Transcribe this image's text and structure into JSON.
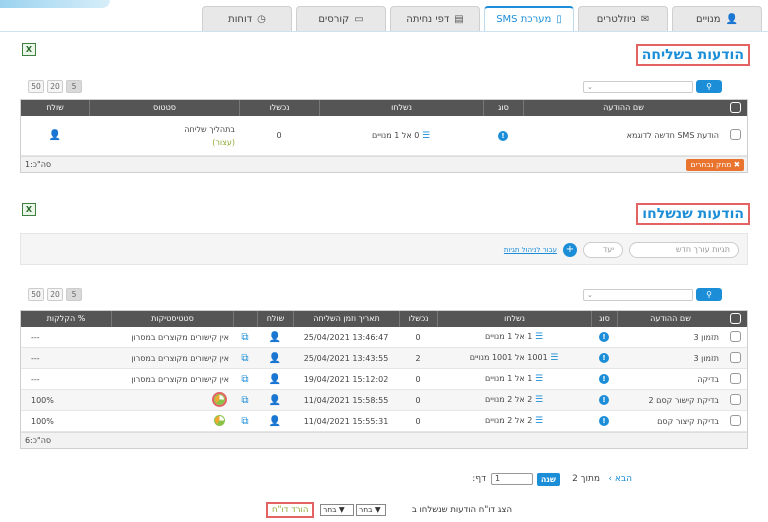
{
  "tabs": [
    {
      "label": "מנויים",
      "icon": "user-icon"
    },
    {
      "label": "ניוזלטרים",
      "icon": "envelope-icon"
    },
    {
      "label": "מערכת SMS",
      "icon": "mobile-icon",
      "active": true
    },
    {
      "label": "דפי נחיתה",
      "icon": "landing-page-icon"
    },
    {
      "label": "קורסים",
      "icon": "monitor-icon"
    },
    {
      "label": "דוחות",
      "icon": "clock-icon"
    }
  ],
  "sending": {
    "title": "הודעות בשליחה",
    "page_sizes": [
      "5",
      "20",
      "50"
    ],
    "columns": [
      "שם ההודעה",
      "סוג",
      "נשלחו",
      "נכשלו",
      "סטטוס",
      "שולח"
    ],
    "rows": [
      {
        "name": "הודעת SMS חדשה לדוגמא",
        "sent": "0 אל 1 מנויים",
        "failed": "0",
        "status": "בתהליך שליחה",
        "status_sub": "(עצור)"
      }
    ],
    "delete_label": "מחק נבחרים",
    "total": "סה\"כ:1"
  },
  "sent": {
    "title": "הודעות שנשלחו",
    "filter": {
      "tags_placeholder": "תגיות עורך חדש",
      "target_placeholder": "יעד",
      "manage_tags_link": "עבור לניהול תגיות"
    },
    "page_sizes": [
      "5",
      "20",
      "50"
    ],
    "columns": [
      "שם ההודעה",
      "סוג",
      "נשלחו",
      "נכשלו",
      "תאריך וזמן השליחה",
      "שולח",
      "",
      "סטטיסטיקות",
      "% הקלקות"
    ],
    "rows": [
      {
        "name": "תזמון 3",
        "sent": "1 אל 1 מנויים",
        "failed": "0",
        "date": "13:46:47 25/04/2021",
        "stats": "אין קישורים מקוצרים במסרון",
        "clicks": "---"
      },
      {
        "name": "תזמון 3",
        "sent": "1001 אל 1001 מנויים",
        "failed": "2",
        "date": "13:43:55 25/04/2021",
        "stats": "אין קישורים מקוצרים במסרון",
        "clicks": "---"
      },
      {
        "name": "בדיקה",
        "sent": "1 אל 1 מנויים",
        "failed": "0",
        "date": "15:12:02 19/04/2021",
        "stats": "אין קישורים מקוצרים במסרון",
        "clicks": "---"
      },
      {
        "name": "בדיקת קישור קסם 2",
        "sent": "2 אל 2 מנויים",
        "failed": "0",
        "date": "15:58:55 11/04/2021",
        "stats": "",
        "clicks": "100%"
      },
      {
        "name": "בדיקת קיצור קסם",
        "sent": "2 אל 2 מנויים",
        "failed": "0",
        "date": "15:55:31 11/04/2021",
        "stats": "",
        "clicks": "100%"
      }
    ],
    "total": "סה\"כ:6"
  },
  "pagination": {
    "page_label": "דף:",
    "page_value": "1",
    "go_label": "שנה",
    "of_label": "מתוך 2",
    "next_label": "הבא"
  },
  "report": {
    "text": "הצג דו\"ח הודעות שנשלחו ב",
    "select1": "בחר",
    "select2": "בחר",
    "download_label": "הורד דו\"ח"
  }
}
